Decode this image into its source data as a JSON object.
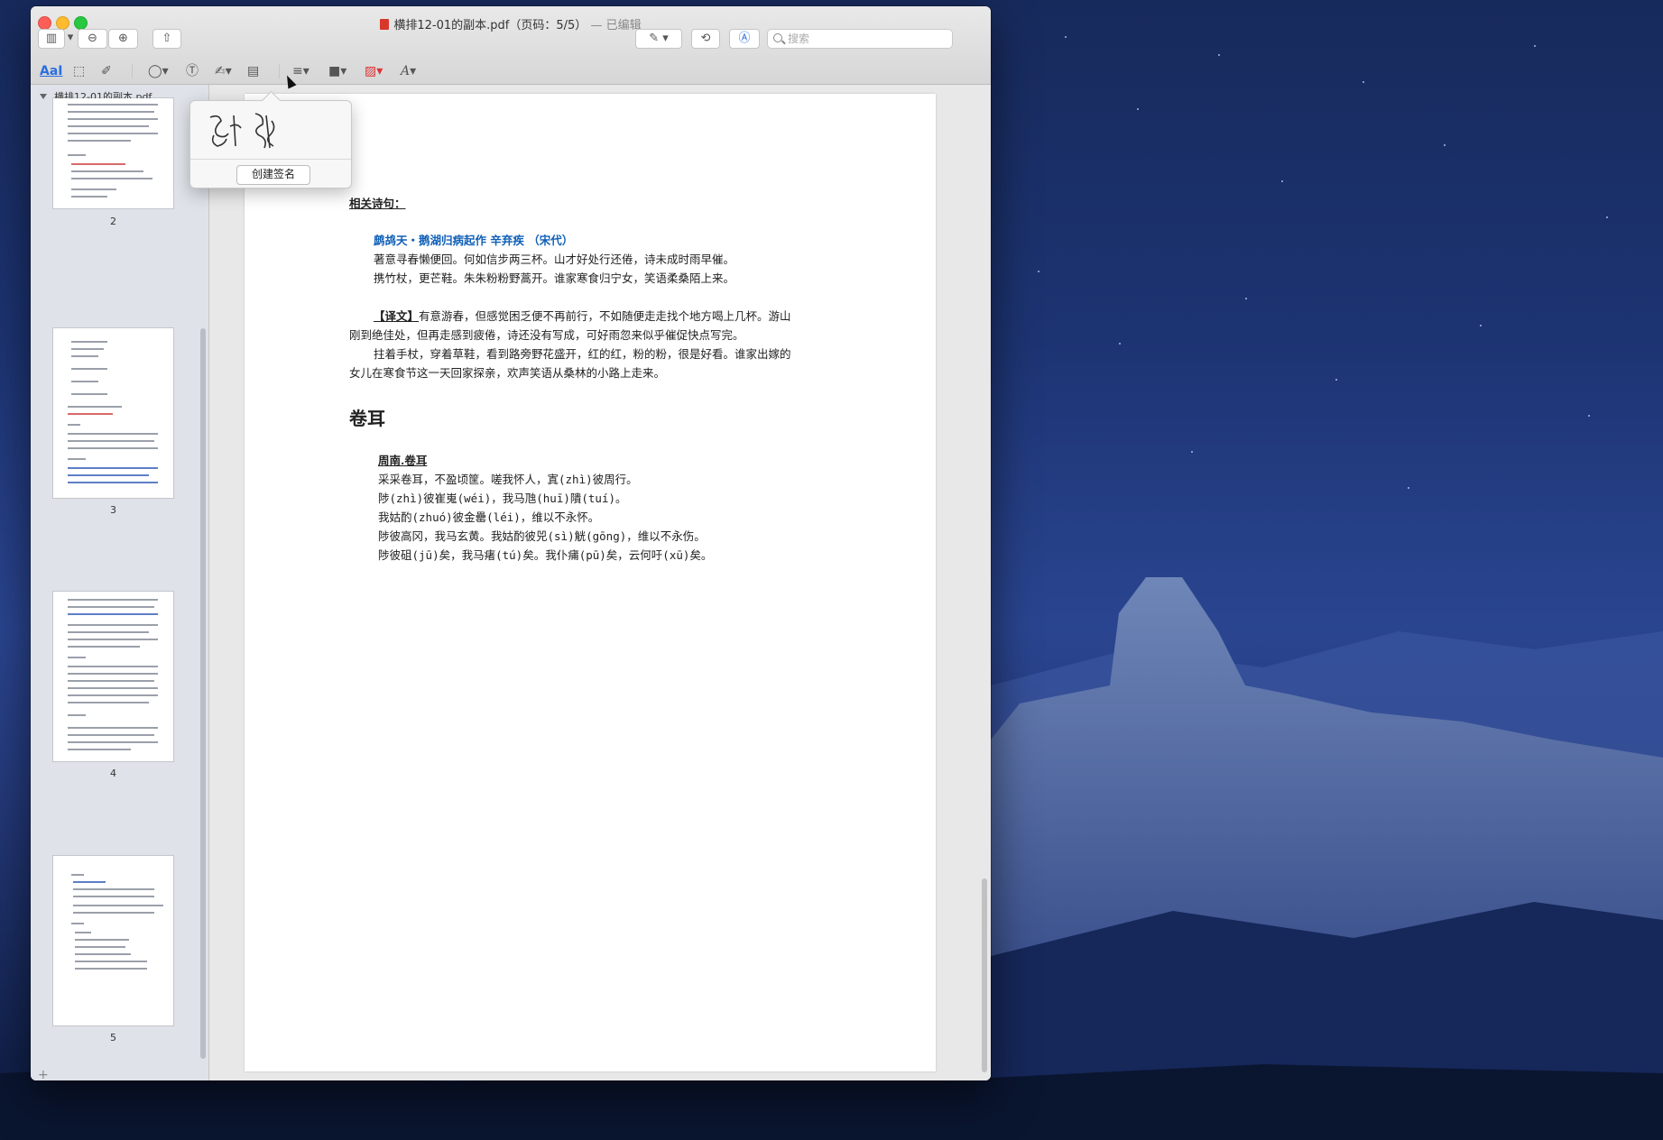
{
  "window": {
    "title": "横排12-01的副本.pdf（页码：5/5）",
    "edited_label": "— 已编辑"
  },
  "toolbar": {
    "search_placeholder": "搜索",
    "text_tool_label": "AaI"
  },
  "sidebar": {
    "file_name": "横排12-01的副本.pdf",
    "pages": [
      {
        "number": "2"
      },
      {
        "number": "3"
      },
      {
        "number": "4"
      },
      {
        "number": "5"
      }
    ]
  },
  "signature_popover": {
    "create_button": "创建签名"
  },
  "document": {
    "heading_related": "相关诗句：",
    "poem1_title": "鹧鸪天・鹅湖归病起作 辛弃疾 （宋代）",
    "poem1_lines": [
      "著意寻春懒便回。何如信步两三杯。山才好处行还倦，诗未成时雨早催。",
      "携竹杖，更芒鞋。朱朱粉粉野蒿开。谁家寒食归宁女，笑语柔桑陌上来。"
    ],
    "translation_label": "【译文】",
    "translation_lines": [
      "有意游春，但感觉困乏便不再前行，不如随便走走找个地方喝上几杯。游山",
      "刚到绝佳处，但再走感到疲倦，诗还没有写成，可好雨忽来似乎催促快点写完。",
      "拄着手杖，穿着草鞋，看到路旁野花盛开，红的红，粉的粉，很是好看。谁家出嫁的",
      "女儿在寒食节这一天回家探亲，欢声笑语从桑林的小路上走来。"
    ],
    "section_title": "卷耳",
    "poem2_title": "周南.卷耳",
    "poem2_lines": [
      "采采卷耳，不盈顷筐。嗟我怀人，寘(zhì)彼周行。",
      "陟(zhì)彼崔嵬(wéi)，我马虺(huī)隤(tuí)。",
      "我姑酌(zhuó)彼金罍(léi)，维以不永怀。",
      "陟彼高冈，我马玄黄。我姑酌彼兕(sì)觥(gōng)，维以不永伤。",
      "陟彼砠(jū)矣，我马瘏(tú)矣。我仆痡(pū)矣，云何吁(xū)矣。"
    ]
  }
}
